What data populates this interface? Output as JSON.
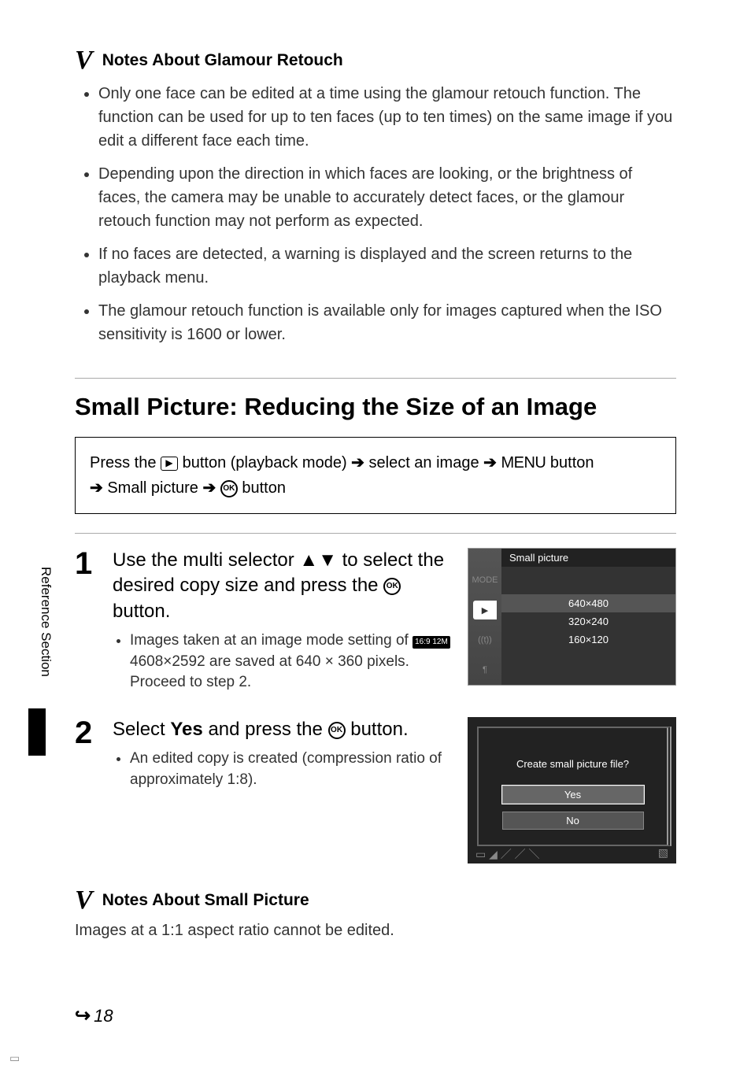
{
  "notes1": {
    "title": "Notes About Glamour Retouch",
    "bullets": [
      "Only one face can be edited at a time using the glamour retouch function. The function can be used for up to ten faces (up to ten times) on the same image if you edit a different face each time.",
      "Depending upon the direction in which faces are looking, or the brightness of faces, the camera may be unable to accurately detect faces, or the glamour retouch function may not perform as expected.",
      "If no faces are detected, a warning is displayed and the screen returns to the playback menu.",
      "The glamour retouch function is available only for images captured when the ISO sensitivity is 1600 or lower."
    ]
  },
  "section_title": "Small Picture: Reducing the Size of an Image",
  "breadcrumb": {
    "p1": "Press the ",
    "p2": " button (playback mode) ",
    "p3": " select an image ",
    "p4_menu": "MENU",
    "p5": " button ",
    "p6": " Small picture ",
    "p7": " button"
  },
  "step1": {
    "num": "1",
    "head_a": "Use the multi selector ",
    "head_b": " to select the desired copy size and press the ",
    "head_c": " button.",
    "sub_a": "Images taken at an image mode setting of ",
    "sub_mode": "16:9 12M",
    "sub_bold": " 4608×2592",
    "sub_b": " are saved at 640 × 360 pixels. Proceed to step 2."
  },
  "screen1": {
    "title": "Small picture",
    "left_mode": "MODE",
    "opts": [
      "640×480",
      "320×240",
      "160×120"
    ]
  },
  "step2": {
    "num": "2",
    "head_a": "Select ",
    "head_bold": "Yes",
    "head_b": " and press the ",
    "head_c": " button.",
    "sub": "An edited copy is created (compression ratio of approximately 1:8)."
  },
  "screen2": {
    "prompt": "Create small picture file?",
    "yes": "Yes",
    "no": "No"
  },
  "notes2": {
    "title": "Notes About Small Picture",
    "body": "Images at a 1:1 aspect ratio cannot be edited."
  },
  "side": "Reference Section",
  "page": "18"
}
